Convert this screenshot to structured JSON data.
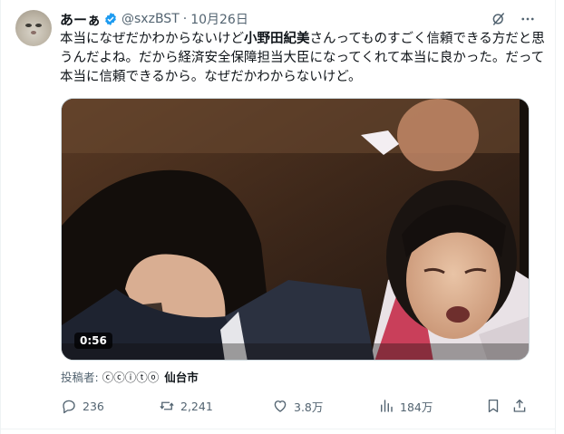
{
  "author": {
    "display_name": "あーぁ",
    "handle": "@sxzBST",
    "separator": "·",
    "date": "10月26日",
    "verified": true
  },
  "tweet": {
    "text_before": "本当になぜだかわからないけど",
    "text_bold": "小野田紀美",
    "text_after": "さんってものすごく信頼できる方だと思うんだよね。だから経済安全保障担当大臣になってくれて本当に良かった。だって本当に信頼できるから。なぜだかわからないけど。"
  },
  "media": {
    "duration": "0:56"
  },
  "poster": {
    "label": "投稿者:",
    "license": "ⓒⓒⓘⓣⓞ",
    "location": "仙台市"
  },
  "actions": {
    "replies": "236",
    "retweets": "2,241",
    "likes": "3.8万",
    "views": "184万"
  },
  "icons": [
    "grok-icon",
    "more-icon",
    "reply-icon",
    "retweet-icon",
    "like-icon",
    "views-icon",
    "bookmark-icon",
    "share-icon"
  ],
  "colors": {
    "text_primary": "#0f1419",
    "text_secondary": "#536471",
    "verified_blue": "#1d9bf0"
  }
}
